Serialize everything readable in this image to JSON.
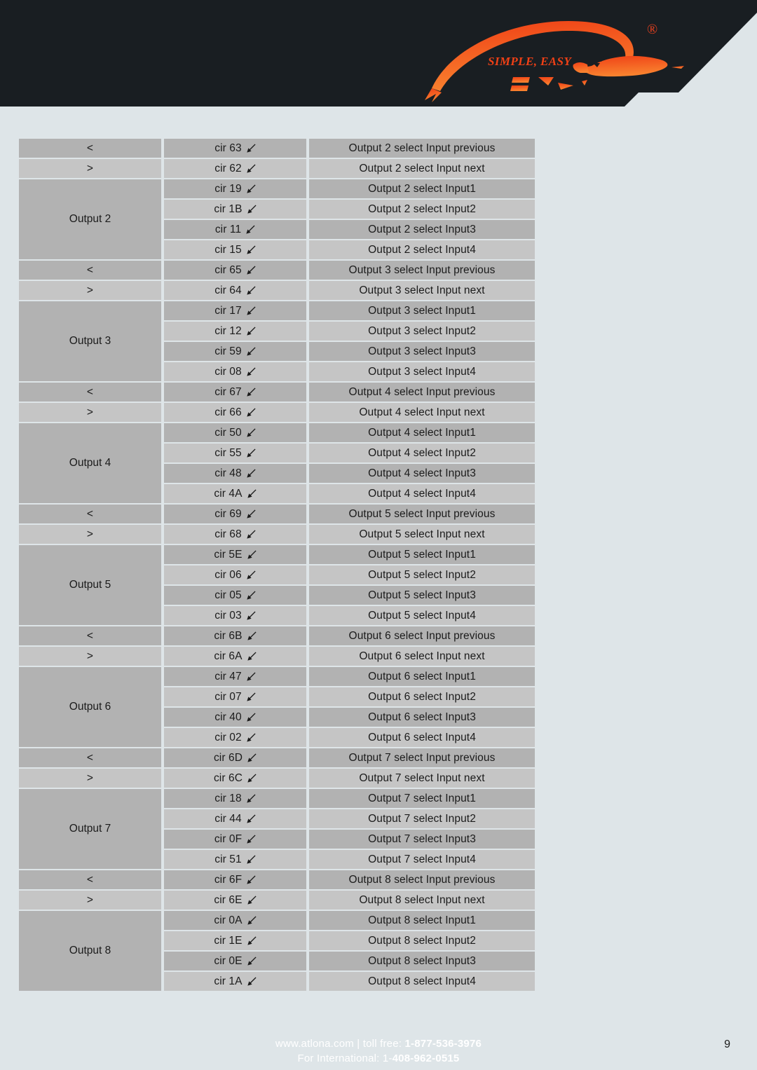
{
  "header": {
    "brand_tagline": "SIMPLE, EASY",
    "registered_mark": "®",
    "logo_name": "atlona-stingray-logo",
    "accent_color": "#e8401f",
    "background_color": "#191e22"
  },
  "table": {
    "page_background": "#dee5e8",
    "row_shade_dark": "#b2b2b2",
    "row_shade_light": "#c5c5c5",
    "arrow_icon": "arrow-down-left-icon",
    "groups": [
      {
        "nav_rows": [
          {
            "label": "<",
            "code": "cir 63",
            "desc": "Output 2 select Input previous"
          },
          {
            "label": ">",
            "code": "cir 62",
            "desc": "Output 2 select Input next"
          }
        ],
        "group_label": "Output 2",
        "input_rows": [
          {
            "code": "cir 19",
            "desc": "Output 2 select Input1"
          },
          {
            "code": "cir 1B",
            "desc": "Output 2 select Input2"
          },
          {
            "code": "cir 11",
            "desc": "Output 2 select Input3"
          },
          {
            "code": "cir 15",
            "desc": "Output 2 select Input4"
          }
        ]
      },
      {
        "nav_rows": [
          {
            "label": "<",
            "code": "cir 65",
            "desc": "Output 3 select Input previous"
          },
          {
            "label": ">",
            "code": "cir 64",
            "desc": "Output 3 select Input next"
          }
        ],
        "group_label": "Output 3",
        "input_rows": [
          {
            "code": "cir 17",
            "desc": "Output 3 select Input1"
          },
          {
            "code": "cir 12",
            "desc": "Output 3 select Input2"
          },
          {
            "code": "cir 59",
            "desc": "Output 3 select Input3"
          },
          {
            "code": "cir 08",
            "desc": "Output 3 select Input4"
          }
        ]
      },
      {
        "nav_rows": [
          {
            "label": "<",
            "code": "cir 67",
            "desc": "Output 4 select Input previous"
          },
          {
            "label": ">",
            "code": "cir 66",
            "desc": "Output 4 select Input next"
          }
        ],
        "group_label": "Output 4",
        "input_rows": [
          {
            "code": "cir 50",
            "desc": "Output 4 select Input1"
          },
          {
            "code": "cir 55",
            "desc": "Output 4 select Input2"
          },
          {
            "code": "cir 48",
            "desc": "Output 4 select Input3"
          },
          {
            "code": "cir 4A",
            "desc": "Output 4 select Input4"
          }
        ]
      },
      {
        "nav_rows": [
          {
            "label": "<",
            "code": "cir 69",
            "desc": "Output 5 select Input previous"
          },
          {
            "label": ">",
            "code": "cir 68",
            "desc": "Output 5 select Input next"
          }
        ],
        "group_label": "Output 5",
        "input_rows": [
          {
            "code": "cir 5E",
            "desc": "Output 5 select Input1"
          },
          {
            "code": "cir 06",
            "desc": "Output 5 select Input2"
          },
          {
            "code": "cir 05",
            "desc": "Output 5 select Input3"
          },
          {
            "code": "cir 03",
            "desc": "Output 5 select Input4"
          }
        ]
      },
      {
        "nav_rows": [
          {
            "label": "<",
            "code": "cir 6B",
            "desc": "Output 6 select Input previous"
          },
          {
            "label": ">",
            "code": "cir 6A",
            "desc": "Output 6 select Input next"
          }
        ],
        "group_label": "Output 6",
        "input_rows": [
          {
            "code": "cir 47",
            "desc": "Output 6 select Input1"
          },
          {
            "code": "cir 07",
            "desc": "Output 6 select Input2"
          },
          {
            "code": "cir 40",
            "desc": "Output 6 select Input3"
          },
          {
            "code": "cir 02",
            "desc": "Output 6 select Input4"
          }
        ]
      },
      {
        "nav_rows": [
          {
            "label": "<",
            "code": "cir 6D",
            "desc": "Output 7 select Input previous"
          },
          {
            "label": ">",
            "code": "cir 6C",
            "desc": "Output 7 select Input next"
          }
        ],
        "group_label": "Output 7",
        "input_rows": [
          {
            "code": "cir 18",
            "desc": "Output 7 select Input1"
          },
          {
            "code": "cir 44",
            "desc": "Output 7 select Input2"
          },
          {
            "code": "cir 0F",
            "desc": "Output 7 select Input3"
          },
          {
            "code": "cir 51",
            "desc": "Output 7 select Input4"
          }
        ]
      },
      {
        "nav_rows": [
          {
            "label": "<",
            "code": "cir 6F",
            "desc": "Output 8 select Input previous"
          },
          {
            "label": ">",
            "code": "cir 6E",
            "desc": "Output 8 select Input next"
          }
        ],
        "group_label": "Output 8",
        "input_rows": [
          {
            "code": "cir 0A",
            "desc": "Output 8 select Input1"
          },
          {
            "code": "cir 1E",
            "desc": "Output 8 select Input2"
          },
          {
            "code": "cir 0E",
            "desc": "Output 8 select Input3"
          },
          {
            "code": "cir 1A",
            "desc": "Output 8 select Input4"
          }
        ]
      }
    ]
  },
  "footer": {
    "line1_prefix": "www.atlona.com | toll free: ",
    "line1_phone": "1-877-536-3976",
    "line2_prefix": "For International: 1-",
    "line2_phone": "408-962-0515",
    "page_number": "9"
  }
}
